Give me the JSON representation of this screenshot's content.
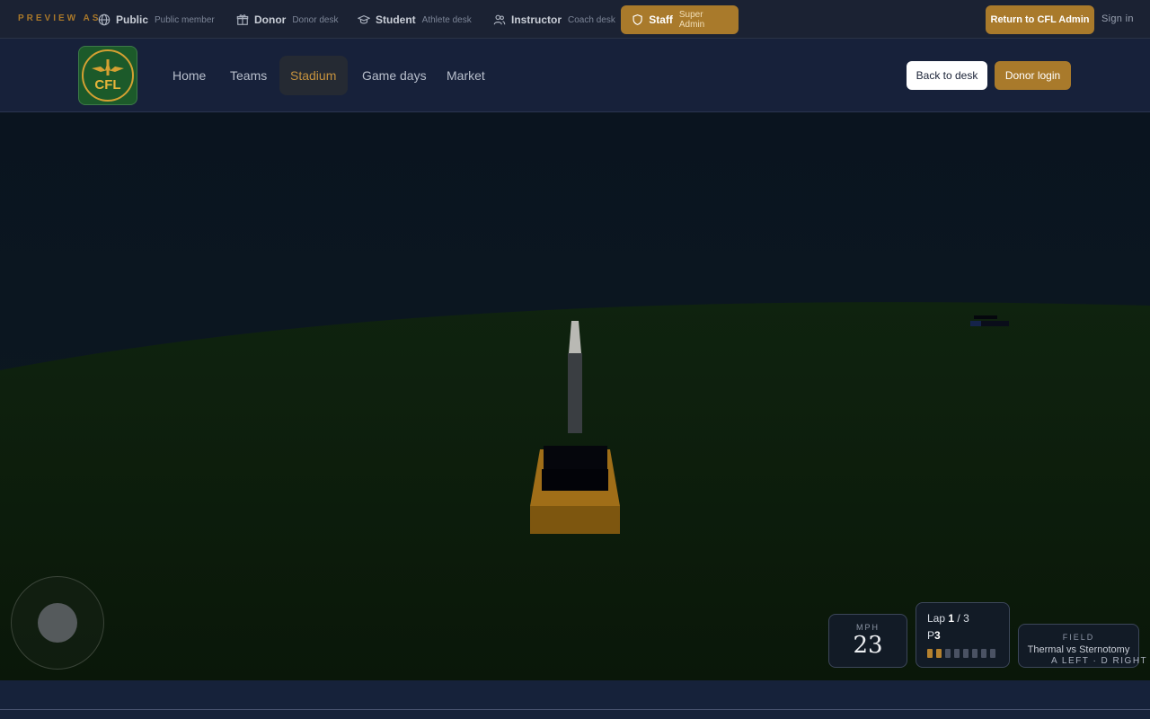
{
  "preview_bar": {
    "label": "PREVIEW AS",
    "roles": [
      {
        "name": "Public",
        "sub": "Public member",
        "icon": "globe-icon"
      },
      {
        "name": "Donor",
        "sub": "Donor desk",
        "icon": "gift-icon"
      },
      {
        "name": "Student",
        "sub": "Athlete desk",
        "icon": "graduation-cap-icon"
      },
      {
        "name": "Instructor",
        "sub": "Coach desk",
        "icon": "users-icon"
      },
      {
        "name": "Staff",
        "sub": "Super Admin",
        "icon": "shield-icon",
        "active": true
      }
    ],
    "return_label": "Return to CFL Admin",
    "signin_label": "Sign in"
  },
  "nav": {
    "logo_text": "CFL",
    "links": [
      "Home",
      "Teams",
      "Stadium",
      "Game days",
      "Market"
    ],
    "active_link": "Stadium",
    "back_label": "Back to desk",
    "donor_login_label": "Donor login"
  },
  "hud": {
    "speed_label": "MPH",
    "speed_value": "23",
    "lap_prefix": "Lap",
    "lap_current": "1",
    "lap_sep": "/ 3",
    "position_prefix": "P",
    "position_value": "3",
    "position_total": 8,
    "position_filled": 2,
    "field_label": "FIELD",
    "field_value": "Thermal vs Sternotomy",
    "controls_hint": "A LEFT · D RIGHT"
  },
  "colors": {
    "accent": "#a97a2b",
    "sky": "#0b1520",
    "grass": "#0c1a0c",
    "car_body": "#a06e18"
  }
}
